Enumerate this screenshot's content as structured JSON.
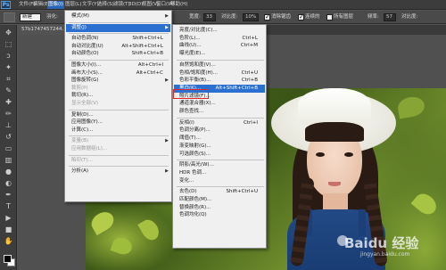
{
  "app": {
    "logo": "Ps"
  },
  "menubar": {
    "items": [
      "文件(F)",
      "编辑(E)",
      "图像(I)",
      "图层(L)",
      "文字(Y)",
      "选择(S)",
      "滤镜(T)",
      "3D(D)",
      "视图(V)",
      "窗口(W)",
      "帮助(H)"
    ],
    "active": "图像(I)"
  },
  "options": {
    "mode": "新建",
    "feather_label": "羽化:",
    "width_label": "宽度:",
    "width_value": "33",
    "contrast_label": "对比度:",
    "contrast_value": "10%",
    "freq_label": "频率:",
    "freq_value": "57",
    "anti_alias_label": "消除锯齿",
    "sample_all_label": "连续的",
    "all_layers_label": "所有图层",
    "anti_alias_checked": true,
    "sample_all_checked": true,
    "all_layers_checked": false
  },
  "document": {
    "tab_title": "57b1747457244..."
  },
  "image_menu": {
    "items": [
      {
        "label": "模式(M)",
        "shortcut": "",
        "submenu": true,
        "disabled": false
      },
      {
        "sep": true
      },
      {
        "label": "调整(J)",
        "shortcut": "",
        "submenu": true,
        "disabled": false,
        "highlight": true
      },
      {
        "sep": true
      },
      {
        "label": "自动色调(N)",
        "shortcut": "Shift+Ctrl+L",
        "submenu": false,
        "disabled": false
      },
      {
        "label": "自动对比度(U)",
        "shortcut": "Alt+Shift+Ctrl+L",
        "submenu": false,
        "disabled": false
      },
      {
        "label": "自动颜色(O)",
        "shortcut": "Shift+Ctrl+B",
        "submenu": false,
        "disabled": false
      },
      {
        "sep": true
      },
      {
        "label": "图像大小(I)...",
        "shortcut": "Alt+Ctrl+I",
        "submenu": false,
        "disabled": false
      },
      {
        "label": "画布大小(S)...",
        "shortcut": "Alt+Ctrl+C",
        "submenu": false,
        "disabled": false
      },
      {
        "label": "图像旋转(G)",
        "shortcut": "",
        "submenu": true,
        "disabled": false
      },
      {
        "label": "裁剪(P)",
        "shortcut": "",
        "submenu": false,
        "disabled": true
      },
      {
        "label": "裁切(R)...",
        "shortcut": "",
        "submenu": false,
        "disabled": false
      },
      {
        "label": "显示全部(V)",
        "shortcut": "",
        "submenu": false,
        "disabled": true
      },
      {
        "sep": true
      },
      {
        "label": "复制(D)...",
        "shortcut": "",
        "submenu": false,
        "disabled": false
      },
      {
        "label": "应用图像(Y)...",
        "shortcut": "",
        "submenu": false,
        "disabled": false
      },
      {
        "label": "计算(C)...",
        "shortcut": "",
        "submenu": false,
        "disabled": false
      },
      {
        "sep": true
      },
      {
        "label": "变量(B)",
        "shortcut": "",
        "submenu": true,
        "disabled": true
      },
      {
        "label": "应用数据组(L)...",
        "shortcut": "",
        "submenu": false,
        "disabled": true
      },
      {
        "sep": true
      },
      {
        "label": "陷印(T)...",
        "shortcut": "",
        "submenu": false,
        "disabled": true
      },
      {
        "sep": true
      },
      {
        "label": "分析(A)",
        "shortcut": "",
        "submenu": true,
        "disabled": false
      }
    ]
  },
  "adjust_menu": {
    "items": [
      {
        "label": "亮度/对比度(C)...",
        "shortcut": ""
      },
      {
        "label": "色阶(L)...",
        "shortcut": "Ctrl+L"
      },
      {
        "label": "曲线(U)...",
        "shortcut": "Ctrl+M"
      },
      {
        "label": "曝光度(E)...",
        "shortcut": ""
      },
      {
        "sep": true
      },
      {
        "label": "自然饱和度(V)...",
        "shortcut": ""
      },
      {
        "label": "色相/饱和度(H)...",
        "shortcut": "Ctrl+U"
      },
      {
        "label": "色彩平衡(B)...",
        "shortcut": "Ctrl+B"
      },
      {
        "label": "黑白(K)...",
        "shortcut": "Alt+Shift+Ctrl+B",
        "selected": true
      },
      {
        "label": "照片滤镜(F)...",
        "shortcut": ""
      },
      {
        "label": "通道混合器(X)...",
        "shortcut": ""
      },
      {
        "label": "颜色查找...",
        "shortcut": ""
      },
      {
        "sep": true
      },
      {
        "label": "反相(I)",
        "shortcut": "Ctrl+I"
      },
      {
        "label": "色调分离(P)...",
        "shortcut": ""
      },
      {
        "label": "阈值(T)...",
        "shortcut": ""
      },
      {
        "label": "渐变映射(G)...",
        "shortcut": ""
      },
      {
        "label": "可选颜色(S)...",
        "shortcut": ""
      },
      {
        "sep": true
      },
      {
        "label": "阴影/高光(W)...",
        "shortcut": ""
      },
      {
        "label": "HDR 色调...",
        "shortcut": ""
      },
      {
        "label": "变化...",
        "shortcut": ""
      },
      {
        "sep": true
      },
      {
        "label": "去色(D)",
        "shortcut": "Shift+Ctrl+U"
      },
      {
        "label": "匹配颜色(M)...",
        "shortcut": ""
      },
      {
        "label": "替换颜色(R)...",
        "shortcut": ""
      },
      {
        "label": "色调均化(Q)",
        "shortcut": ""
      }
    ]
  },
  "watermark": {
    "main": "Baidu 经验",
    "sub": "jingyan.baidu.com"
  },
  "colors": {
    "highlight": "#2b6fd0",
    "menubar": "#3c3c3c",
    "annotation": "#e0262a"
  }
}
